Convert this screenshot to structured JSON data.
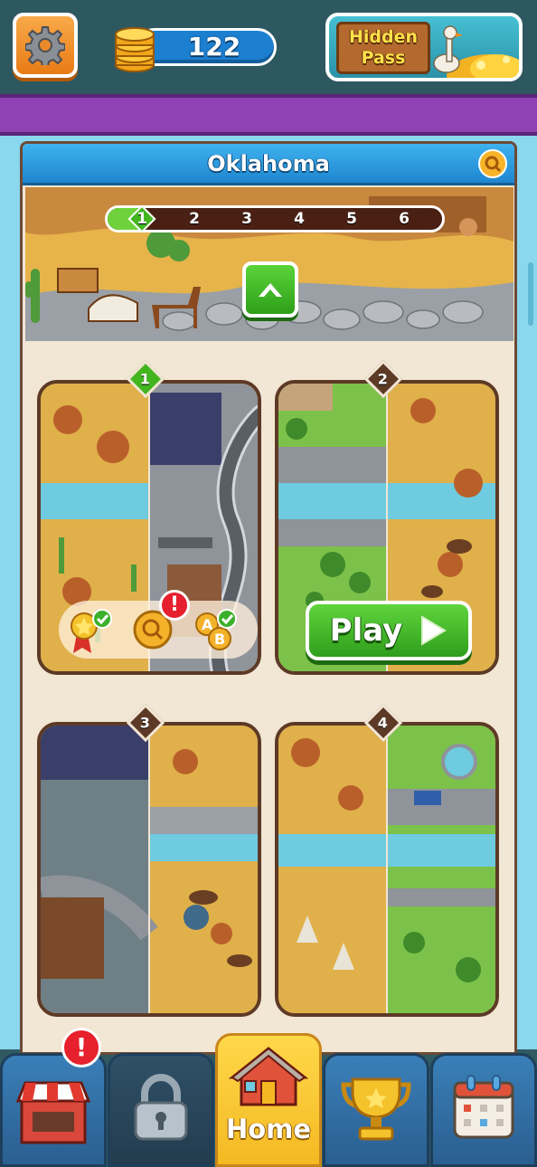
{
  "header": {
    "coins": "122",
    "hidden_pass": {
      "line1": "Hidden",
      "line2": "Pass"
    }
  },
  "panel": {
    "title": "Oklahoma",
    "progress": {
      "steps": [
        "1",
        "2",
        "3",
        "4",
        "5",
        "6"
      ],
      "current_step": 1
    },
    "levels": [
      {
        "number": "1",
        "status": "in-progress"
      },
      {
        "number": "2",
        "status": "selected"
      },
      {
        "number": "3",
        "status": "locked"
      },
      {
        "number": "4",
        "status": "locked"
      }
    ],
    "play_label": "Play"
  },
  "nav": {
    "tabs": [
      {
        "id": "shop",
        "icon": "shop-icon",
        "alert": "!"
      },
      {
        "id": "locked",
        "icon": "lock-icon"
      },
      {
        "id": "home",
        "icon": "house-icon",
        "label": "Home"
      },
      {
        "id": "leaderboard",
        "icon": "trophy-icon"
      },
      {
        "id": "events",
        "icon": "calendar-icon"
      }
    ]
  },
  "card1_status": {
    "alert": "!"
  },
  "colors": {
    "accent_green": "#43b51f",
    "title_blue": "#1f86cf",
    "home_yellow": "#f4b922",
    "panel_bg": "#f2e6d4",
    "badge_dark": "#5d3a26"
  }
}
